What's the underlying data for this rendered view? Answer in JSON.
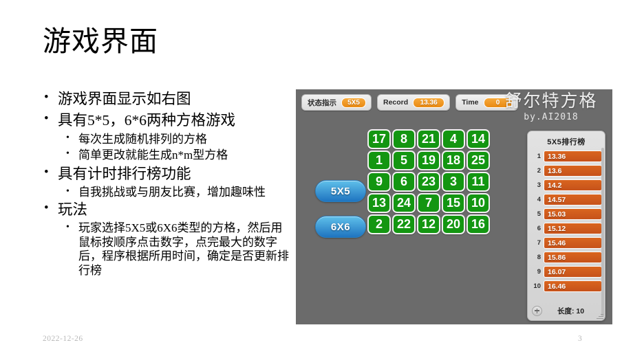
{
  "slide": {
    "title": "游戏界面",
    "bullets": [
      {
        "level": 1,
        "text": "游戏界面显示如右图"
      },
      {
        "level": 1,
        "text": "具有5*5，6*6两种方格游戏"
      },
      {
        "level": 2,
        "text": "每次生成随机排列的方格"
      },
      {
        "level": 2,
        "text": "简单更改就能生成n*m型方格"
      },
      {
        "level": 1,
        "text": "具有计时排行榜功能"
      },
      {
        "level": 2,
        "text": "自我挑战或与朋友比赛，增加趣味性"
      },
      {
        "level": 1,
        "text": "玩法"
      },
      {
        "level": 2,
        "text": "玩家选择5X5或6X6类型的方格，然后用鼠标按顺序点击数字，点完最大的数字后，程序根据所用时间，确定是否更新排行榜"
      }
    ],
    "footer": {
      "date": "2022-12-26",
      "page_number": "3"
    }
  },
  "game": {
    "status": [
      {
        "label": "状态指示",
        "value": "5X5"
      },
      {
        "label": "Record",
        "value": "13.36"
      },
      {
        "label": "Time",
        "value": "0"
      }
    ],
    "brand": {
      "cn": "舒尔特方格",
      "en": "by.AI2018"
    },
    "mode_buttons": [
      {
        "label": "5X5"
      },
      {
        "label": "6X6"
      }
    ],
    "grid": {
      "rows": 5,
      "cols": 5,
      "cells": [
        "17",
        "8",
        "21",
        "4",
        "14",
        "1",
        "5",
        "19",
        "18",
        "25",
        "9",
        "6",
        "23",
        "3",
        "11",
        "13",
        "24",
        "7",
        "15",
        "10",
        "2",
        "22",
        "12",
        "20",
        "16"
      ]
    },
    "leaderboard": {
      "title": "5X5排行榜",
      "entries": [
        {
          "rank": "1",
          "time": "13.36"
        },
        {
          "rank": "2",
          "time": "13.6"
        },
        {
          "rank": "3",
          "time": "14.2"
        },
        {
          "rank": "4",
          "time": "14.57"
        },
        {
          "rank": "5",
          "time": "15.03"
        },
        {
          "rank": "6",
          "time": "15.12"
        },
        {
          "rank": "7",
          "time": "15.46"
        },
        {
          "rank": "8",
          "time": "15.86"
        },
        {
          "rank": "9",
          "time": "16.07"
        },
        {
          "rank": "10",
          "time": "16.46"
        }
      ],
      "length_label": "长度: 10",
      "add_icon": "plus-icon"
    },
    "colors": {
      "panel_bg": "#6b6b6b",
      "tile_green": "#139611",
      "accent_orange": "#ea8a12",
      "rank_orange": "#c6521a",
      "button_blue": "#1f74c0"
    }
  }
}
